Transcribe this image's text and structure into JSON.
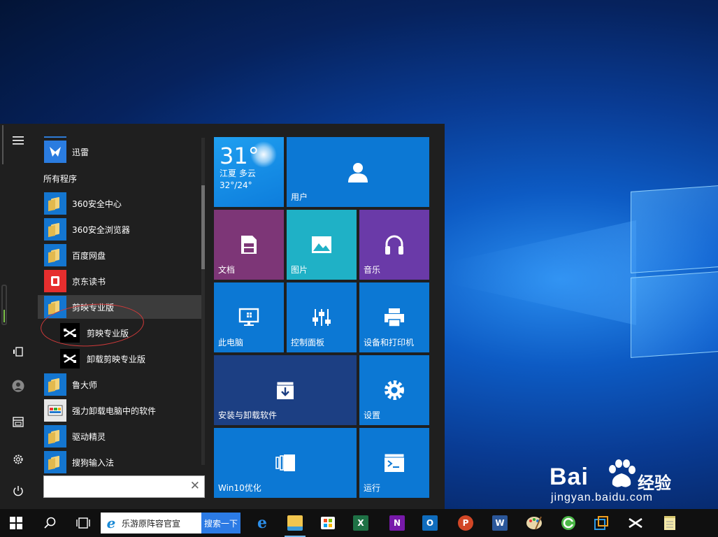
{
  "start_menu": {
    "recent_app": "迅雷",
    "section_header": "所有程序",
    "apps": [
      {
        "label": "360安全中心",
        "icon": "folder-icon"
      },
      {
        "label": "360安全浏览器",
        "icon": "folder-icon"
      },
      {
        "label": "百度网盘",
        "icon": "folder-icon"
      },
      {
        "label": "京东读书",
        "icon": "jd-reader-icon"
      },
      {
        "label": "剪映专业版",
        "icon": "folder-icon",
        "expanded": true
      },
      {
        "label": "剪映专业版",
        "icon": "capcut-icon",
        "sub": true
      },
      {
        "label": "卸载剪映专业版",
        "icon": "capcut-icon",
        "sub": true
      },
      {
        "label": "鲁大师",
        "icon": "folder-icon"
      },
      {
        "label": "强力卸载电脑中的软件",
        "icon": "uninstaller-icon"
      },
      {
        "label": "驱动精灵",
        "icon": "folder-icon"
      },
      {
        "label": "搜狗输入法",
        "icon": "folder-icon"
      }
    ],
    "search_value": ""
  },
  "tiles": {
    "weather": {
      "temp": "31°",
      "city": "江夏 多云",
      "range": "32°/24°"
    },
    "user": "用户",
    "documents": "文档",
    "pictures": "图片",
    "music": "音乐",
    "this_pc": "此电脑",
    "control_panel": "控制面板",
    "devices_printers": "设备和打印机",
    "install_uninstall": "安装与卸载软件",
    "settings": "设置",
    "win10_optimize": "Win10优化",
    "run": "运行"
  },
  "colors": {
    "tile_blue": "#0c78d4",
    "tile_purple": "#7d3677",
    "tile_teal": "#1fb1c6",
    "tile_violet": "#6a3aa8",
    "tile_navy": "#1c3f83",
    "highlight_circle": "#d23a3a"
  },
  "taskbar": {
    "ie_search_text": "乐游原阵容官宣",
    "search_button": "搜索一下"
  },
  "watermark": {
    "brand": "Bai",
    "brand_cn": "经验",
    "url": "jingyan.baidu.com"
  }
}
